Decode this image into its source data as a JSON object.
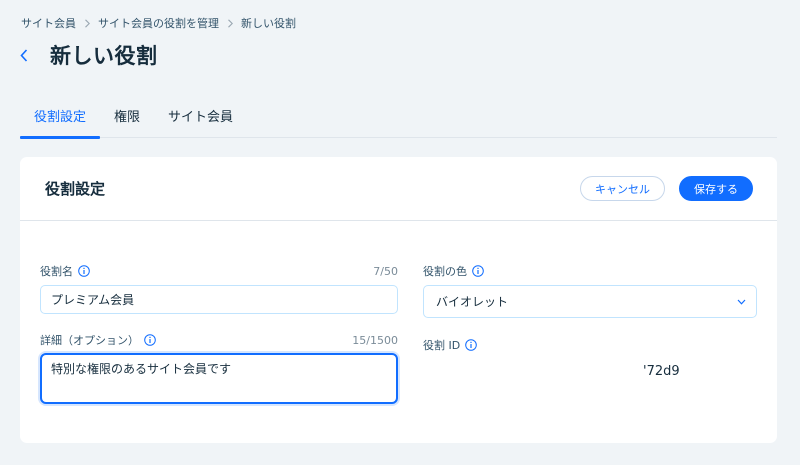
{
  "breadcrumb": {
    "items": [
      "サイト会員",
      "サイト会員の役割を管理",
      "新しい役割"
    ]
  },
  "header": {
    "title": "新しい役割"
  },
  "tabs": [
    "役割設定",
    "権限",
    "サイト会員"
  ],
  "card": {
    "title": "役割設定",
    "cancel_label": "キャンセル",
    "save_label": "保存する"
  },
  "form": {
    "role_name": {
      "label": "役割名",
      "counter": "7/50",
      "value": "プレミアム会員"
    },
    "details": {
      "label": "詳細（オプション）",
      "counter": "15/1500",
      "value": "特別な権限のあるサイト会員です"
    },
    "color": {
      "label": "役割の色",
      "value": "バイオレット"
    },
    "role_id": {
      "label": "役割 ID",
      "value": "'72d9"
    }
  },
  "colors": {
    "accent": "#116dff",
    "page_bg": "#f0f4f7",
    "text": "#162d3d"
  },
  "icons": {
    "back": "chevron-left-icon",
    "breadcrumb_sep": "chevron-right-icon",
    "info": "info-icon",
    "dropdown": "chevron-down-icon"
  }
}
